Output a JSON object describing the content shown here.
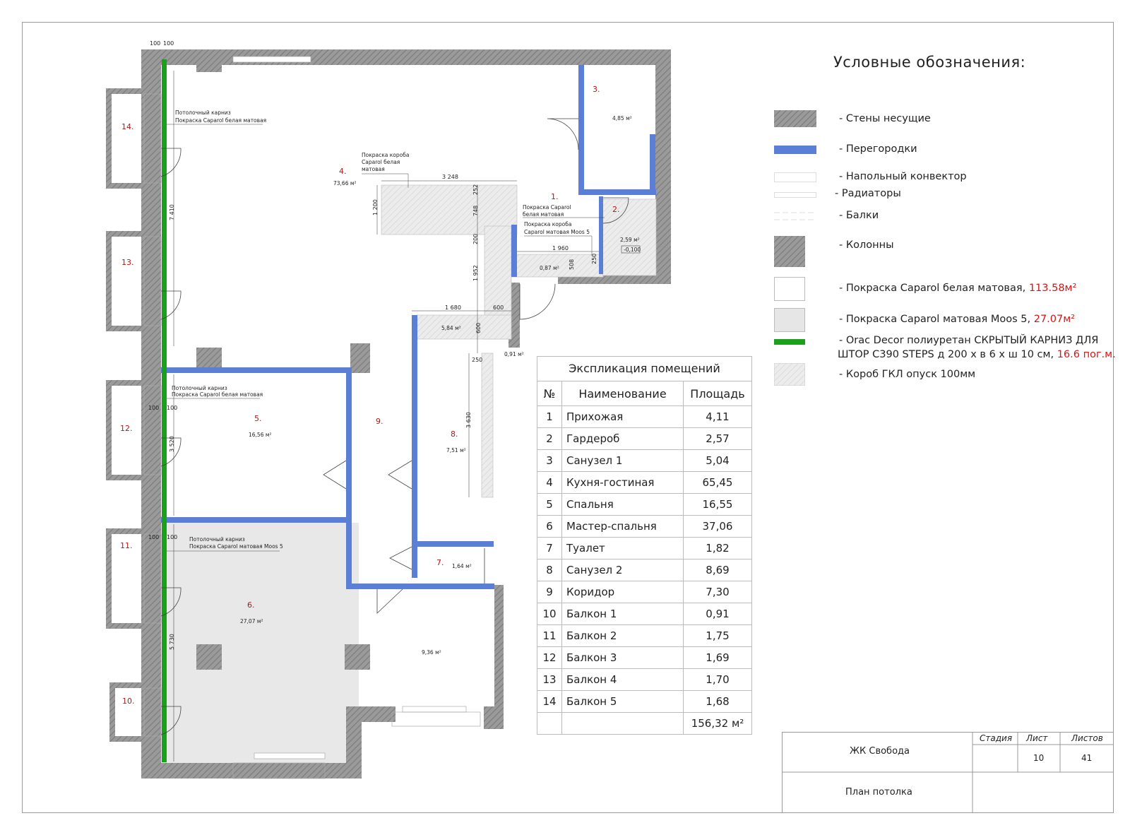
{
  "legend": {
    "title": "Условные обозначения:",
    "items": [
      {
        "label": "- Стены несущие",
        "icon": "hatch-wall"
      },
      {
        "label": "- Перегородки",
        "icon": "partition",
        "color": "#5b7fd6"
      },
      {
        "label": "- Напольный конвектор",
        "icon": "convector"
      },
      {
        "label": "- Радиаторы",
        "icon": "radiator"
      },
      {
        "label": "- Балки",
        "icon": "beam"
      },
      {
        "label": "- Колонны",
        "icon": "column"
      },
      {
        "label": "- Покраска  Caparol белая матовая, ",
        "extra": "113.58м²",
        "icon": "paint-white"
      },
      {
        "label": "- Покраска  Caparol матовая Moos 5, ",
        "extra": "27.07м²",
        "icon": "paint-moos"
      },
      {
        "label": "- Orac Decor полиуретан СКРЫТЫЙ КАРНИЗ ДЛЯ",
        "label2": "ШТОР C390 STEPS д 200 х в 6 х ш 10 см, ",
        "extra": "16.6 пог.м.",
        "icon": "cornice",
        "color": "#1aa01a"
      },
      {
        "label": "- Короб ГКЛ опуск 100мм",
        "icon": "gkl-box"
      }
    ]
  },
  "explication": {
    "title": "Экспликация помещений",
    "headers": [
      "№",
      "Наименование",
      "Площадь"
    ],
    "rows": [
      [
        "1",
        "Прихожая",
        "4,11"
      ],
      [
        "2",
        "Гардероб",
        "2,57"
      ],
      [
        "3",
        "Санузел 1",
        "5,04"
      ],
      [
        "4",
        "Кухня-гостиная",
        "65,45"
      ],
      [
        "5",
        "Спальня",
        "16,55"
      ],
      [
        "6",
        "Мастер-спальня",
        "37,06"
      ],
      [
        "7",
        "Туалет",
        "1,82"
      ],
      [
        "8",
        "Санузел 2",
        "8,69"
      ],
      [
        "9",
        "Коридор",
        "7,30"
      ],
      [
        "10",
        "Балкон 1",
        "0,91"
      ],
      [
        "11",
        "Балкон 2",
        "1,75"
      ],
      [
        "12",
        "Балкон 3",
        "1,69"
      ],
      [
        "13",
        "Балкон 4",
        "1,70"
      ],
      [
        "14",
        "Балкон 5",
        "1,68"
      ]
    ],
    "total": "156,32 м²"
  },
  "stamp": {
    "project": "ЖК Свобода",
    "sheet_title": "План потолка",
    "stage_label": "Стадия",
    "sheet_label": "Лист",
    "sheets_label": "Листов",
    "sheet": "10",
    "sheets": "41"
  },
  "plan": {
    "rooms": [
      {
        "num": "1.",
        "area": ""
      },
      {
        "num": "2.",
        "area": "2,59 м²"
      },
      {
        "num": "3.",
        "area": "4,85 м²"
      },
      {
        "num": "4.",
        "area": "73,66 м²"
      },
      {
        "num": "5.",
        "area": "16,56 м²"
      },
      {
        "num": "6.",
        "area": "27,07 м²"
      },
      {
        "num": "7.",
        "area": "1,64 м²"
      },
      {
        "num": "8.",
        "area": "7,51 м²"
      },
      {
        "num": "9.",
        "area": "9,36 м²"
      },
      {
        "num": "10.",
        "area": ""
      },
      {
        "num": "11.",
        "area": ""
      },
      {
        "num": "12.",
        "area": ""
      },
      {
        "num": "13.",
        "area": ""
      },
      {
        "num": "14.",
        "area": ""
      }
    ],
    "extra_areas": [
      "0,87 м²",
      "5,84 м²",
      "0,91 м²"
    ],
    "level_mark": "-0,100",
    "notes": {
      "cornice1_a": "Потолочный карниз",
      "cornice1_b": "Покраска Caparol белая матовая",
      "cornice2_a": "Потолочный карниз",
      "cornice2_b": "Покраска Caparol белая матовая",
      "cornice3_a": "Потолочный карниз",
      "cornice3_b": "Покраска Caparol матовая Moos 5",
      "box1_a": "Покраска короба",
      "box1_b": "Caparol белая",
      "box1_c": "матовая",
      "caparol1_a": "Покраска Caparol",
      "caparol1_b": "белая матовая",
      "box2_a": "Покраска короба",
      "box2_b": "Caparol матовая Moos 5"
    },
    "dims": {
      "d100a": "100",
      "d100b": "100",
      "d100c": "100",
      "d100d": "100",
      "d100e": "100",
      "d100f": "100",
      "d7410": "7 410",
      "d3520": "3 520",
      "d5730": "5 730",
      "d3248": "3 248",
      "d1200": "1 200",
      "d252": "252",
      "d748": "748",
      "d200": "200",
      "d1952": "1 952",
      "d1960": "1 960",
      "d508": "508",
      "d250a": "250",
      "d1680": "1 680",
      "d600a": "600",
      "d600b": "600",
      "d250b": "250",
      "d3630": "3 630"
    }
  }
}
